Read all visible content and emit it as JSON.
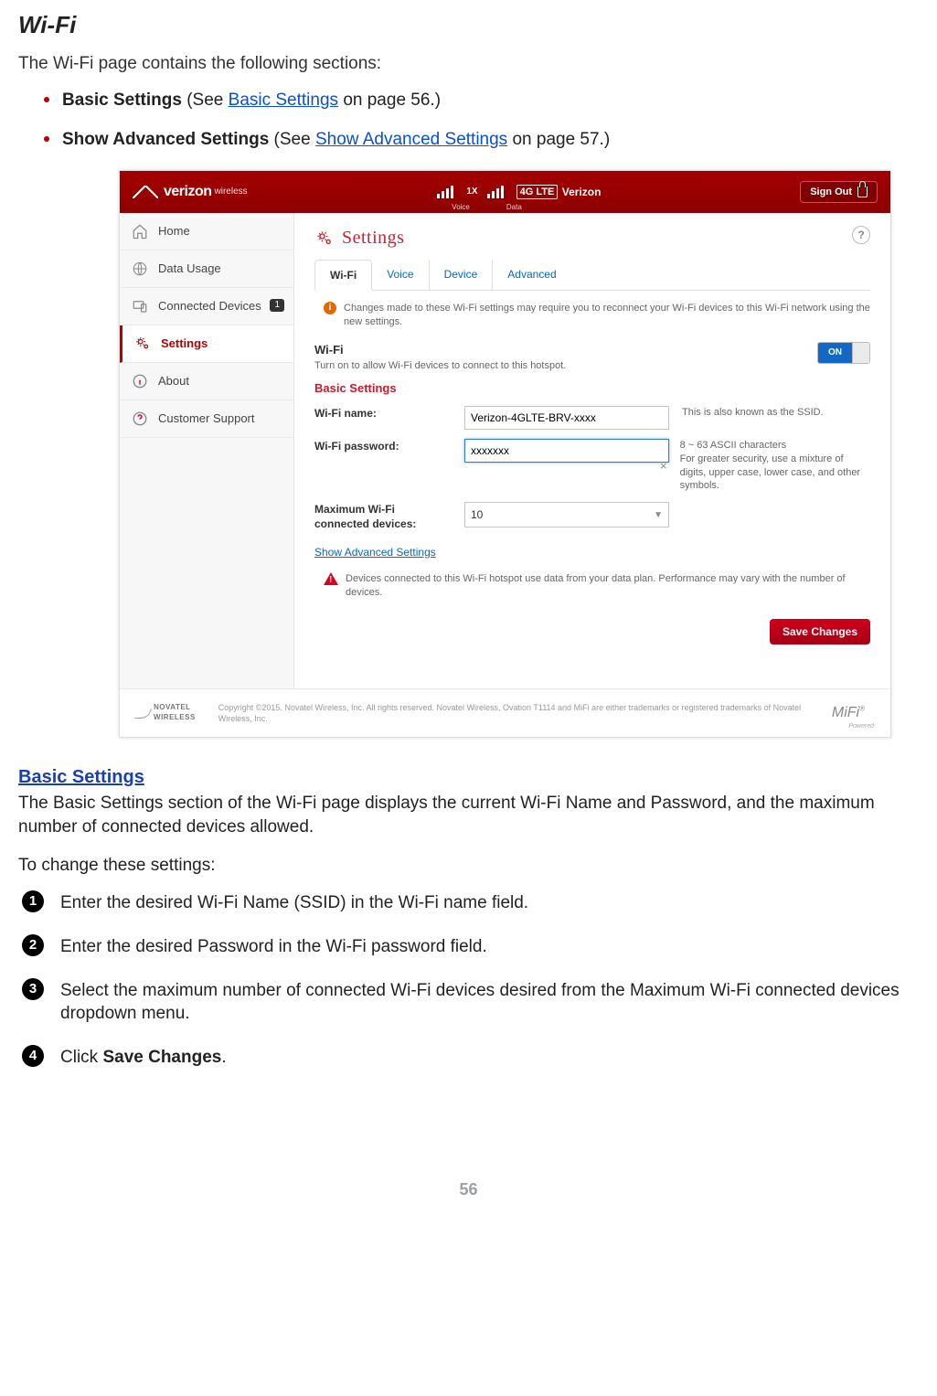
{
  "doc": {
    "title": "Wi-Fi",
    "intro": "The Wi-Fi page contains the following sections:",
    "bullets": [
      {
        "bold": "Basic Settings",
        "mid": " (See ",
        "link": "Basic Settings",
        "after": " on page 56.)"
      },
      {
        "bold": "Show Advanced Settings",
        "mid": " (See ",
        "link": "Show Advanced Settings",
        "after": " on page 57.)"
      }
    ],
    "section_heading": "Basic Settings",
    "section_text": "The Basic Settings section of the Wi-Fi page displays the current  Wi-Fi Name and Password, and the maximum number of connected devices allowed.",
    "steps_intro": "To change these settings:",
    "steps": [
      "Enter the desired Wi-Fi Name (SSID) in the Wi-Fi name field.",
      "Enter the desired Password in the Wi-Fi password field.",
      "Select the maximum number of connected Wi-Fi devices desired from the Maximum Wi-Fi connected devices dropdown menu.",
      "Click Save Changes."
    ],
    "step4_prefix": "Click ",
    "step4_bold": "Save Changes",
    "step4_suffix": ".",
    "page_number": "56"
  },
  "topbar": {
    "brand_main": "verizon",
    "brand_sub": "wireless",
    "voice_label": "Voice",
    "voice_tech": "1X",
    "data_label": "Data",
    "lte": "4G LTE",
    "carrier": "Verizon",
    "signout": "Sign Out"
  },
  "sidebar": {
    "items": [
      {
        "label": "Home"
      },
      {
        "label": "Data Usage"
      },
      {
        "label": "Connected Devices",
        "badge": "1"
      },
      {
        "label": "Settings"
      },
      {
        "label": "About"
      },
      {
        "label": "Customer Support"
      }
    ]
  },
  "main": {
    "title": "Settings",
    "tabs": [
      "Wi-Fi",
      "Voice",
      "Device",
      "Advanced"
    ],
    "info_msg": "Changes made to these Wi-Fi settings may require you to reconnect your Wi-Fi devices to this Wi-Fi network using the new settings.",
    "wifi_head": "Wi-Fi",
    "wifi_sub": "Turn on to allow Wi-Fi devices to connect to this hotspot.",
    "toggle_on": "ON",
    "basic_head": "Basic Settings",
    "name_label": "Wi-Fi name:",
    "name_value": "Verizon-4GLTE-BRV-xxxx",
    "name_hint": "This is also known as the SSID.",
    "pw_label": "Wi-Fi password:",
    "pw_value": "xxxxxxx",
    "pw_hint": "8 ~ 63 ASCII characters\nFor greater security, use a mixture of digits, upper case, lower case, and other symbols.",
    "max_label": "Maximum Wi-Fi connected devices:",
    "max_value": "10",
    "adv_link": "Show Advanced Settings",
    "warn_msg": "Devices connected to this Wi-Fi hotspot use data from your data plan. Performance may vary with the number of devices.",
    "save_btn": "Save Changes"
  },
  "footer": {
    "novatel": "NOVATEL WIRELESS",
    "copyright": "Copyright ©2015. Novatel Wireless, Inc. All rights reserved. Novatel Wireless, Ovation T1114 and MiFi are either trademarks or registered trademarks of Novatel Wireless, Inc.",
    "mifi": "MiFi",
    "mifi_sub": "Powered"
  }
}
